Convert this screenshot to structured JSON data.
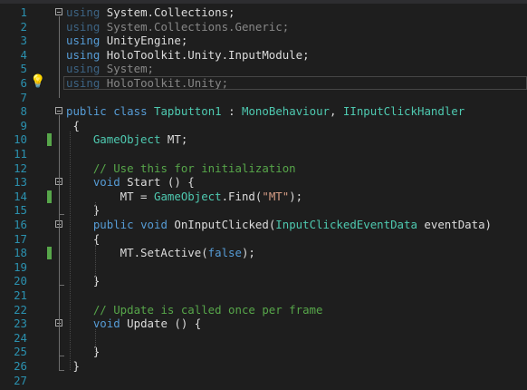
{
  "window": {
    "title_fragment": "⌒"
  },
  "lines": [
    {
      "n": "1",
      "tokens": [
        {
          "t": "using",
          "c": "kw fade"
        },
        {
          "t": " System.Collections;"
        }
      ]
    },
    {
      "n": "2",
      "tokens": [
        {
          "t": "using",
          "c": "kw fade"
        },
        {
          "t": " System.Collections.Generic;",
          "c": "fade"
        }
      ]
    },
    {
      "n": "3",
      "tokens": [
        {
          "t": "using",
          "c": "kw"
        },
        {
          "t": " UnityEngine;"
        }
      ]
    },
    {
      "n": "4",
      "tokens": [
        {
          "t": "using",
          "c": "kw"
        },
        {
          "t": " HoloToolkit.Unity.InputModule;"
        }
      ]
    },
    {
      "n": "5",
      "tokens": [
        {
          "t": "using",
          "c": "kw fade"
        },
        {
          "t": " System;",
          "c": "fade"
        }
      ]
    },
    {
      "n": "6",
      "tokens": [
        {
          "t": "using",
          "c": "kw fade"
        },
        {
          "t": " HoloToolkit.Unity;",
          "c": "fade"
        }
      ]
    },
    {
      "n": "7",
      "tokens": []
    },
    {
      "n": "8",
      "tokens": [
        {
          "t": "public",
          "c": "kw"
        },
        {
          "t": " "
        },
        {
          "t": "class",
          "c": "kw"
        },
        {
          "t": " "
        },
        {
          "t": "Tapbutton1",
          "c": "ty"
        },
        {
          "t": " : "
        },
        {
          "t": "MonoBehaviour",
          "c": "ty"
        },
        {
          "t": ", "
        },
        {
          "t": "IInputClickHandler",
          "c": "ty"
        }
      ]
    },
    {
      "n": "9",
      "tokens": [
        {
          "t": " {"
        }
      ]
    },
    {
      "n": "10",
      "tokens": [
        {
          "t": "    "
        },
        {
          "t": "GameObject",
          "c": "ty"
        },
        {
          "t": " MT;"
        }
      ]
    },
    {
      "n": "11",
      "tokens": []
    },
    {
      "n": "12",
      "tokens": [
        {
          "t": "    "
        },
        {
          "t": "// Use this for initialization",
          "c": "cm"
        }
      ]
    },
    {
      "n": "13",
      "tokens": [
        {
          "t": "    "
        },
        {
          "t": "void",
          "c": "kw"
        },
        {
          "t": " Start () {"
        }
      ]
    },
    {
      "n": "14",
      "tokens": [
        {
          "t": "        MT = "
        },
        {
          "t": "GameObject",
          "c": "ty"
        },
        {
          "t": ".Find("
        },
        {
          "t": "\"MT\"",
          "c": "st"
        },
        {
          "t": ");"
        }
      ]
    },
    {
      "n": "15",
      "tokens": [
        {
          "t": "    }"
        }
      ]
    },
    {
      "n": "16",
      "tokens": [
        {
          "t": "    "
        },
        {
          "t": "public",
          "c": "kw"
        },
        {
          "t": " "
        },
        {
          "t": "void",
          "c": "kw"
        },
        {
          "t": " OnInputClicked("
        },
        {
          "t": "InputClickedEventData",
          "c": "ty"
        },
        {
          "t": " eventData)"
        }
      ]
    },
    {
      "n": "17",
      "tokens": [
        {
          "t": "    {"
        }
      ]
    },
    {
      "n": "18",
      "tokens": [
        {
          "t": "        MT.SetActive("
        },
        {
          "t": "false",
          "c": "kw"
        },
        {
          "t": ");"
        }
      ]
    },
    {
      "n": "19",
      "tokens": []
    },
    {
      "n": "20",
      "tokens": [
        {
          "t": "    }"
        }
      ]
    },
    {
      "n": "21",
      "tokens": []
    },
    {
      "n": "22",
      "tokens": [
        {
          "t": "    "
        },
        {
          "t": "// Update is called once per frame",
          "c": "cm"
        }
      ]
    },
    {
      "n": "23",
      "tokens": [
        {
          "t": "    "
        },
        {
          "t": "void",
          "c": "kw"
        },
        {
          "t": " Update () {"
        }
      ]
    },
    {
      "n": "24",
      "tokens": []
    },
    {
      "n": "25",
      "tokens": [
        {
          "t": "    }"
        }
      ]
    },
    {
      "n": "26",
      "tokens": [
        {
          "t": " }"
        }
      ]
    },
    {
      "n": "27",
      "tokens": []
    }
  ],
  "change_marks": [
    "10",
    "14",
    "18"
  ],
  "fold_markers": [
    "1",
    "8",
    "13",
    "16",
    "23"
  ],
  "lightbulb_line": "6",
  "colors": {
    "background": "#1e1e1e",
    "line_number": "#2b91af",
    "keyword": "#569cd6",
    "type": "#4ec9b0",
    "comment": "#57a64a",
    "string": "#d69d85",
    "text": "#dcdcdc",
    "change_bar": "#57a64a"
  },
  "icons": {
    "lightbulb": "lightbulb-icon",
    "fold": "collapse-icon"
  }
}
